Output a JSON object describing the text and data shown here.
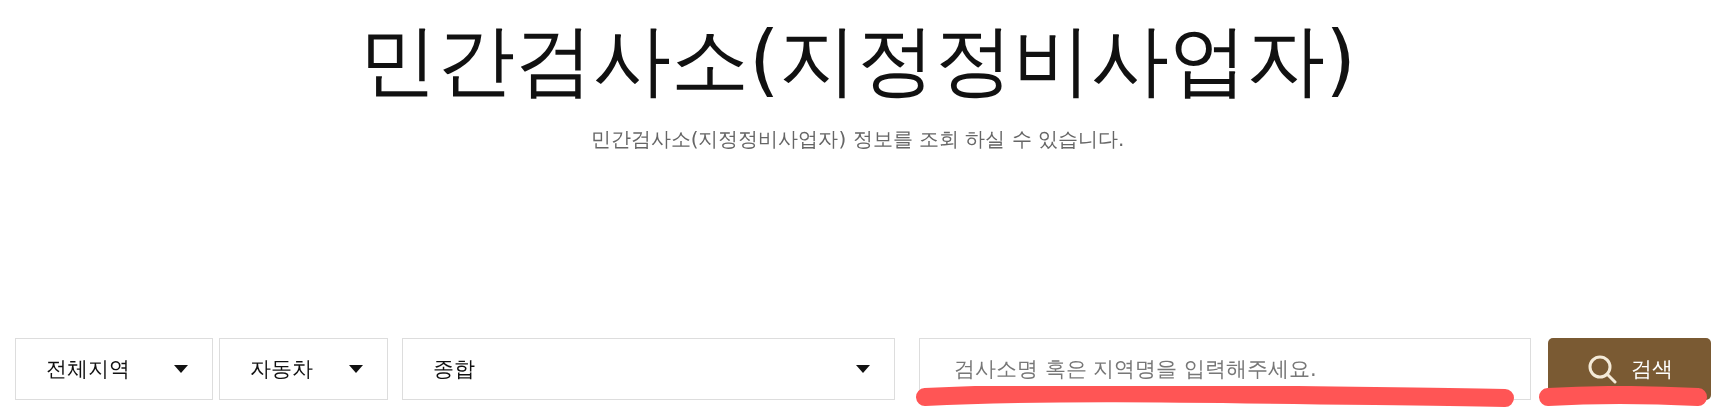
{
  "header": {
    "title": "민간검사소(지정정비사업자)",
    "subtitle": "민간검사소(지정정비사업자) 정보를 조회 하실 수 있습니다."
  },
  "filters": [
    {
      "value": "전체지역",
      "kind": "short"
    },
    {
      "value": "자동차",
      "kind": "short"
    },
    {
      "value": "종합",
      "kind": "wide"
    }
  ],
  "search": {
    "placeholder": "검사소명 혹은 지역명을 입력해주세요.",
    "button": "검색"
  }
}
